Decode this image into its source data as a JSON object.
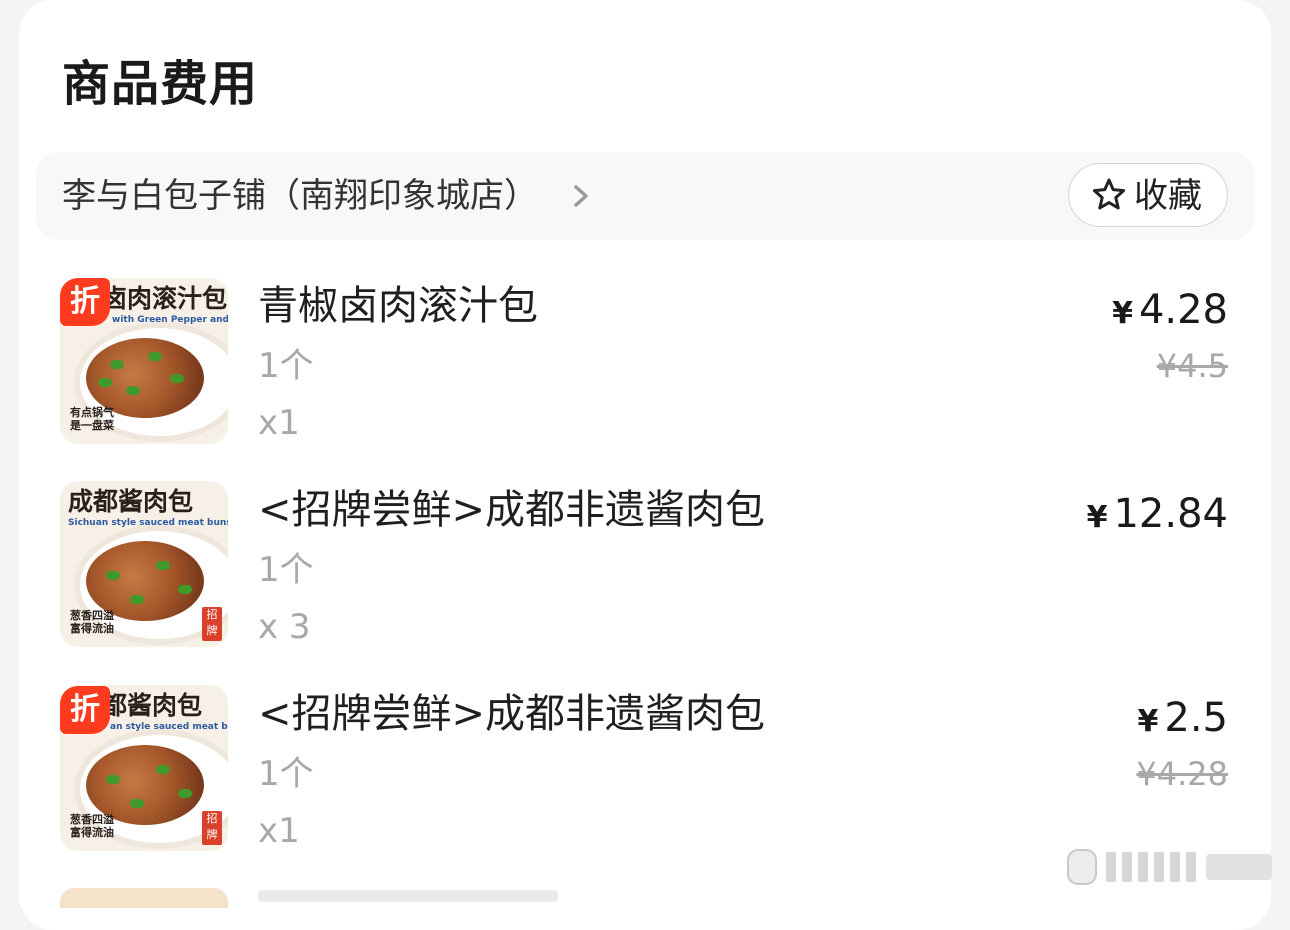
{
  "section": {
    "title": "商品费用"
  },
  "store": {
    "name": "李与白包子铺（南翔印象城店）",
    "favorite_label": "收藏"
  },
  "items": [
    {
      "name": "青椒卤肉滚汁包",
      "spec": "1个",
      "quantity": "x1",
      "currency": "¥",
      "price": "4.28",
      "original_price": "¥4.5",
      "discount_badge": "折",
      "thumb": {
        "title": "卤肉滚汁包",
        "subtitle": "with Green Pepper and Roll Sauce Bun",
        "footer_1": "有点锅气",
        "footer_2": "是一盘菜"
      }
    },
    {
      "name": "<招牌尝鲜>成都非遗酱肉包",
      "spec": "1个",
      "quantity": "x 3",
      "currency": "¥",
      "price": "12.84",
      "thumb": {
        "title": "成都酱肉包",
        "subtitle": "Sichuan style sauced meat buns",
        "footer_1": "葱香四溢",
        "footer_2": "富得流油",
        "stamp": "招牌"
      }
    },
    {
      "name": "<招牌尝鲜>成都非遗酱肉包",
      "spec": "1个",
      "quantity": "x1",
      "currency": "¥",
      "price": "2.5",
      "original_price": "¥4.28",
      "discount_badge": "折",
      "thumb": {
        "title": "都酱肉包",
        "subtitle": "an style sauced meat buns",
        "footer_1": "葱香四溢",
        "footer_2": "富得流油",
        "stamp": "招牌"
      }
    }
  ],
  "colors": {
    "discount": "#ff3b1f",
    "background": "#f4f4f4",
    "card": "#ffffff",
    "muted_text": "#a8a8a8"
  },
  "icons": {
    "store_chevron": "chevron-right-icon",
    "favorite": "star-outline-icon",
    "watermark": "weibo-watermark"
  }
}
